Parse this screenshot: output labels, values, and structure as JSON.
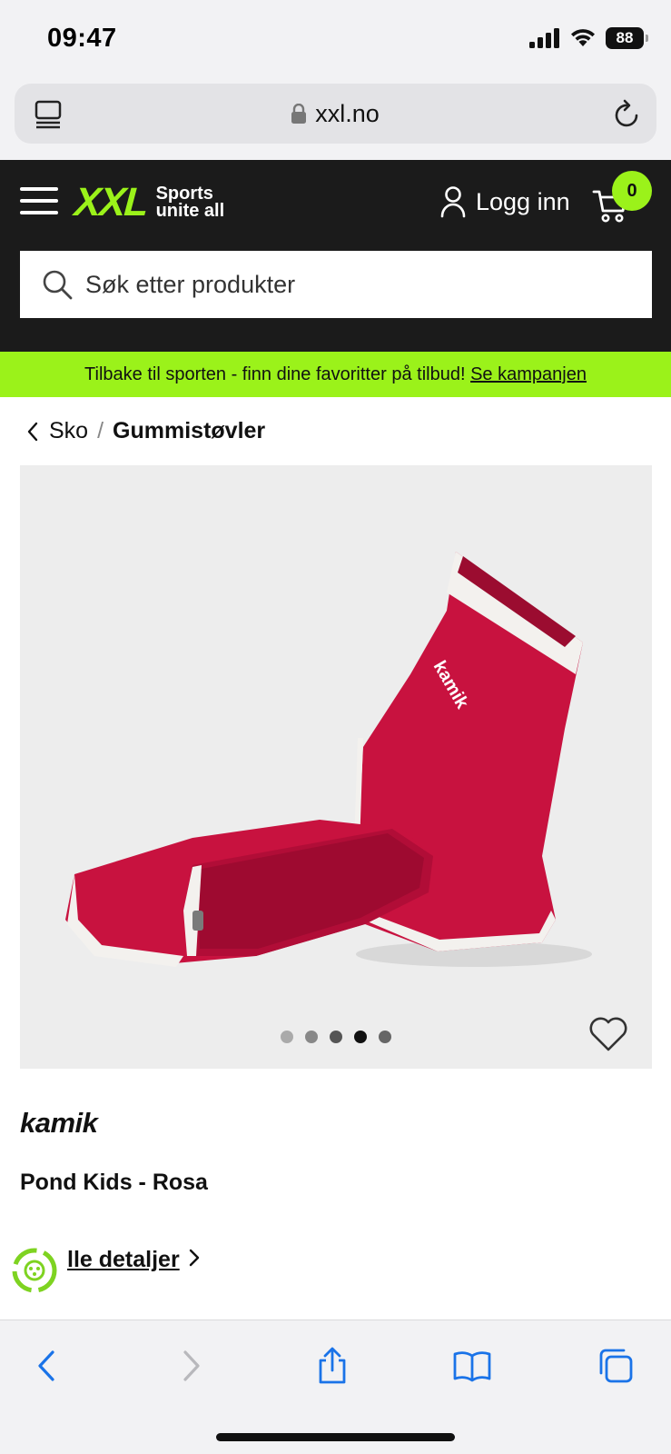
{
  "status_bar": {
    "time": "09:47",
    "battery": "88"
  },
  "browser": {
    "url": "xxl.no"
  },
  "header": {
    "logo_text": "XXL",
    "logo_tagline_line1": "Sports",
    "logo_tagline_line2": "unite all",
    "login_label": "Logg inn",
    "cart_count": "0",
    "search_placeholder": "Søk etter produkter",
    "accent_color": "#9bf21a"
  },
  "promo": {
    "text": "Tilbake til sporten - finn dine favoritter på tilbud!",
    "link": "Se kampanjen"
  },
  "breadcrumb": {
    "parent": "Sko",
    "separator": "/",
    "current": "Gummistøvler"
  },
  "gallery": {
    "image_count": 5,
    "active_index": 3
  },
  "product": {
    "brand": "kamik",
    "name": "Pond Kids - Rosa",
    "details_link": "lle detaljer"
  }
}
